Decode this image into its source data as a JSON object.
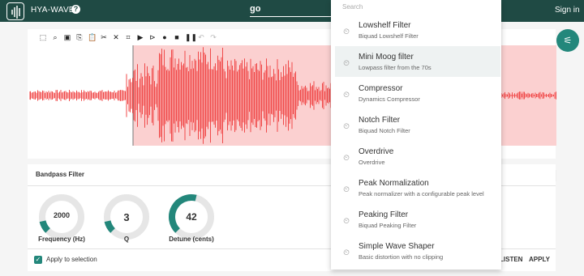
{
  "header": {
    "app_name": "HYA-WAVE",
    "help_icon": "?",
    "search_value": "go",
    "sign_in": "Sign in"
  },
  "toolbar": {
    "icons": [
      "select-region-icon",
      "zoom-icon",
      "select-all-icon",
      "copy-icon",
      "paste-icon",
      "cut-icon",
      "delete-icon",
      "crop-icon",
      "play-icon",
      "play-selection-icon",
      "record-icon",
      "stop-icon",
      "pause-icon",
      "undo-icon",
      "redo-icon"
    ]
  },
  "filter_panel": {
    "title": "Bandpass Filter",
    "knobs": [
      {
        "label": "Frequency (Hz)",
        "value": "2000",
        "level": 0.12
      },
      {
        "label": "Q",
        "value": "3",
        "level": 0.12
      },
      {
        "label": "Detune (cents)",
        "value": "42",
        "level": 0.55
      }
    ],
    "apply_to_selection": "Apply to selection",
    "listen_label": "LISTEN",
    "apply_label": "APPLY"
  },
  "dropdown": {
    "search_placeholder": "Search",
    "items": [
      {
        "name": "Lowshelf Filter",
        "desc": "Biquad Lowshelf Filter"
      },
      {
        "name": "Mini Moog filter",
        "desc": "Lowpass filter from the 70s"
      },
      {
        "name": "Compressor",
        "desc": "Dynamics Compressor"
      },
      {
        "name": "Notch Filter",
        "desc": "Biquad Notch Filter"
      },
      {
        "name": "Overdrive",
        "desc": "Overdrive"
      },
      {
        "name": "Peak Normalization",
        "desc": "Peak normalizer with a configurable peak level"
      },
      {
        "name": "Peaking Filter",
        "desc": "Biquad Peaking Filter"
      },
      {
        "name": "Simple Wave Shaper",
        "desc": "Basic distortion with no clipping"
      }
    ]
  },
  "colors": {
    "header_bg": "#1f4a44",
    "accent": "#23877b",
    "waveform": "#f04a4a",
    "selection": "#fbd0d0"
  }
}
